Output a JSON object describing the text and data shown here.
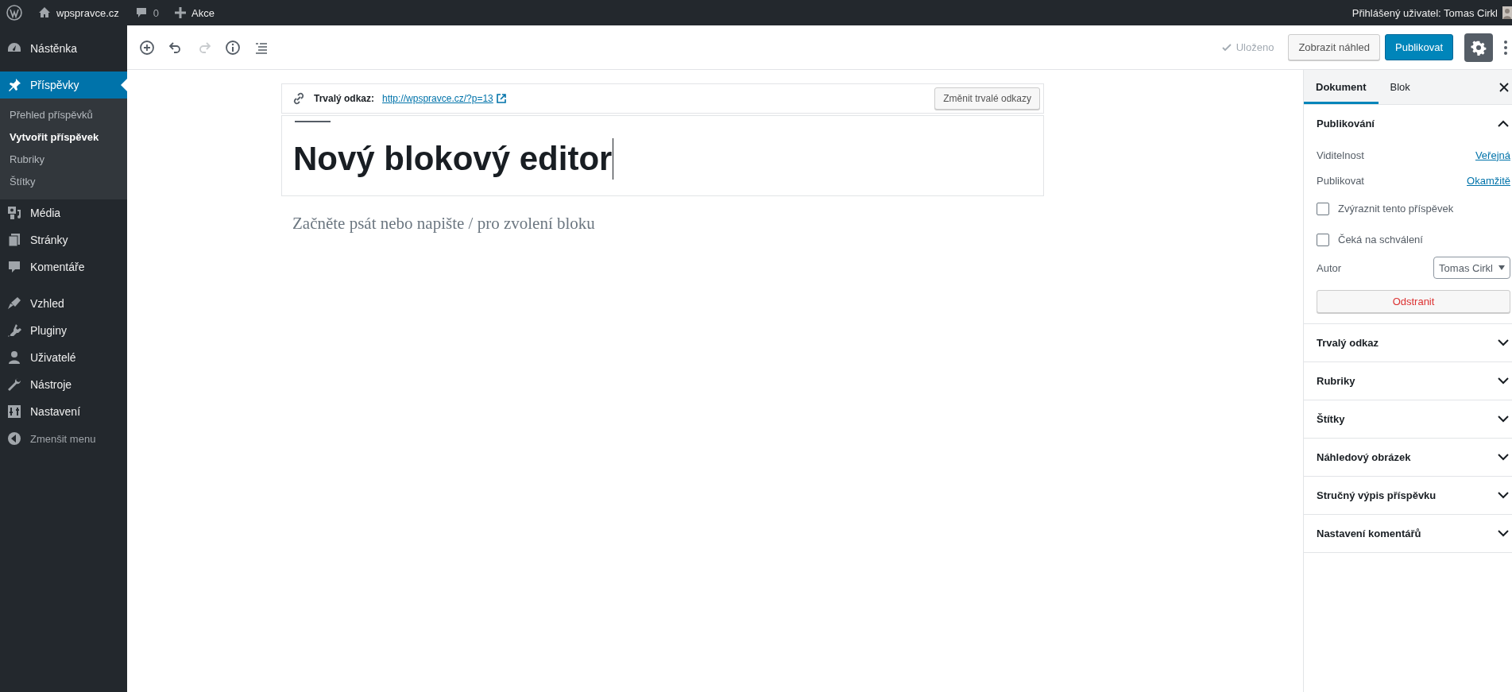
{
  "admin_bar": {
    "site": "wpspravce.cz",
    "comments": "0",
    "new": "Akce",
    "user": "Přihlášený uživatel: Tomas Cirkl"
  },
  "sidebar": {
    "groups": [
      [
        {
          "kind": "menu",
          "label": "Nástěnka",
          "selected": false
        }
      ],
      [
        {
          "kind": "menu",
          "label": "Příspěvky",
          "selected": true,
          "children": [
            {
              "label": "Přehled příspěvků",
              "selected": false
            },
            {
              "label": "Vytvořit příspěvek",
              "selected": true
            },
            {
              "label": "Rubriky",
              "selected": false
            },
            {
              "label": "Štítky",
              "selected": false
            }
          ]
        },
        {
          "kind": "menu",
          "label": "Média",
          "selected": false
        },
        {
          "kind": "menu",
          "label": "Stránky",
          "selected": false
        },
        {
          "kind": "menu",
          "label": "Komentáře",
          "selected": false
        }
      ],
      [
        {
          "kind": "menu",
          "label": "Vzhled",
          "selected": false
        },
        {
          "kind": "menu",
          "label": "Pluginy",
          "selected": false
        },
        {
          "kind": "menu",
          "label": "Uživatelé",
          "selected": false
        },
        {
          "kind": "menu",
          "label": "Nástroje",
          "selected": false
        },
        {
          "kind": "menu",
          "label": "Nastavení",
          "selected": false
        },
        {
          "kind": "collapse",
          "label": "Zmenšit menu",
          "selected": false
        }
      ]
    ]
  },
  "toolbar": {
    "tools": [
      {
        "kind": "add",
        "disabled": false
      },
      {
        "kind": "undo",
        "disabled": false
      },
      {
        "kind": "redo",
        "disabled": true
      },
      {
        "kind": "info",
        "disabled": false
      },
      {
        "kind": "outline",
        "disabled": false
      }
    ],
    "saved_status": "Uloženo",
    "preview_button": "Zobrazit náhled",
    "publish_button": "Publikovat",
    "settings_selected": true
  },
  "editor": {
    "permalink_label": "Trvalý odkaz:",
    "permalink_url": "http://wpspravce.cz/?p=13",
    "permalink_button": "Změnit trvalé odkazy",
    "title": "Nový blokový editor",
    "placeholder": "Začněte psát nebo napište / pro zvolení bloku"
  },
  "panel": {
    "tabs": [
      {
        "label": "Dokument",
        "selected": true
      },
      {
        "label": "Blok",
        "selected": false
      }
    ],
    "sections": [
      {
        "title": "Publikování",
        "expanded": true,
        "fields": [
          {
            "kind": "link",
            "label": "Viditelnost",
            "value": "Veřejná"
          },
          {
            "kind": "link",
            "label": "Publikovat",
            "value": "Okamžitě"
          },
          {
            "kind": "checkbox",
            "label": "Zvýraznit tento příspěvek",
            "checked": false
          },
          {
            "kind": "checkbox",
            "label": "Čeká na schválení",
            "checked": false
          },
          {
            "kind": "select",
            "label": "Autor",
            "value": "Tomas Cirkl"
          },
          {
            "kind": "button",
            "label": "Odstranit"
          }
        ]
      },
      {
        "title": "Trvalý odkaz",
        "expanded": false
      },
      {
        "title": "Rubriky",
        "expanded": false
      },
      {
        "title": "Štítky",
        "expanded": false
      },
      {
        "title": "Náhledový obrázek",
        "expanded": false
      },
      {
        "title": "Stručný výpis příspěvku",
        "expanded": false
      },
      {
        "title": "Nastavení komentářů",
        "expanded": false
      }
    ]
  }
}
